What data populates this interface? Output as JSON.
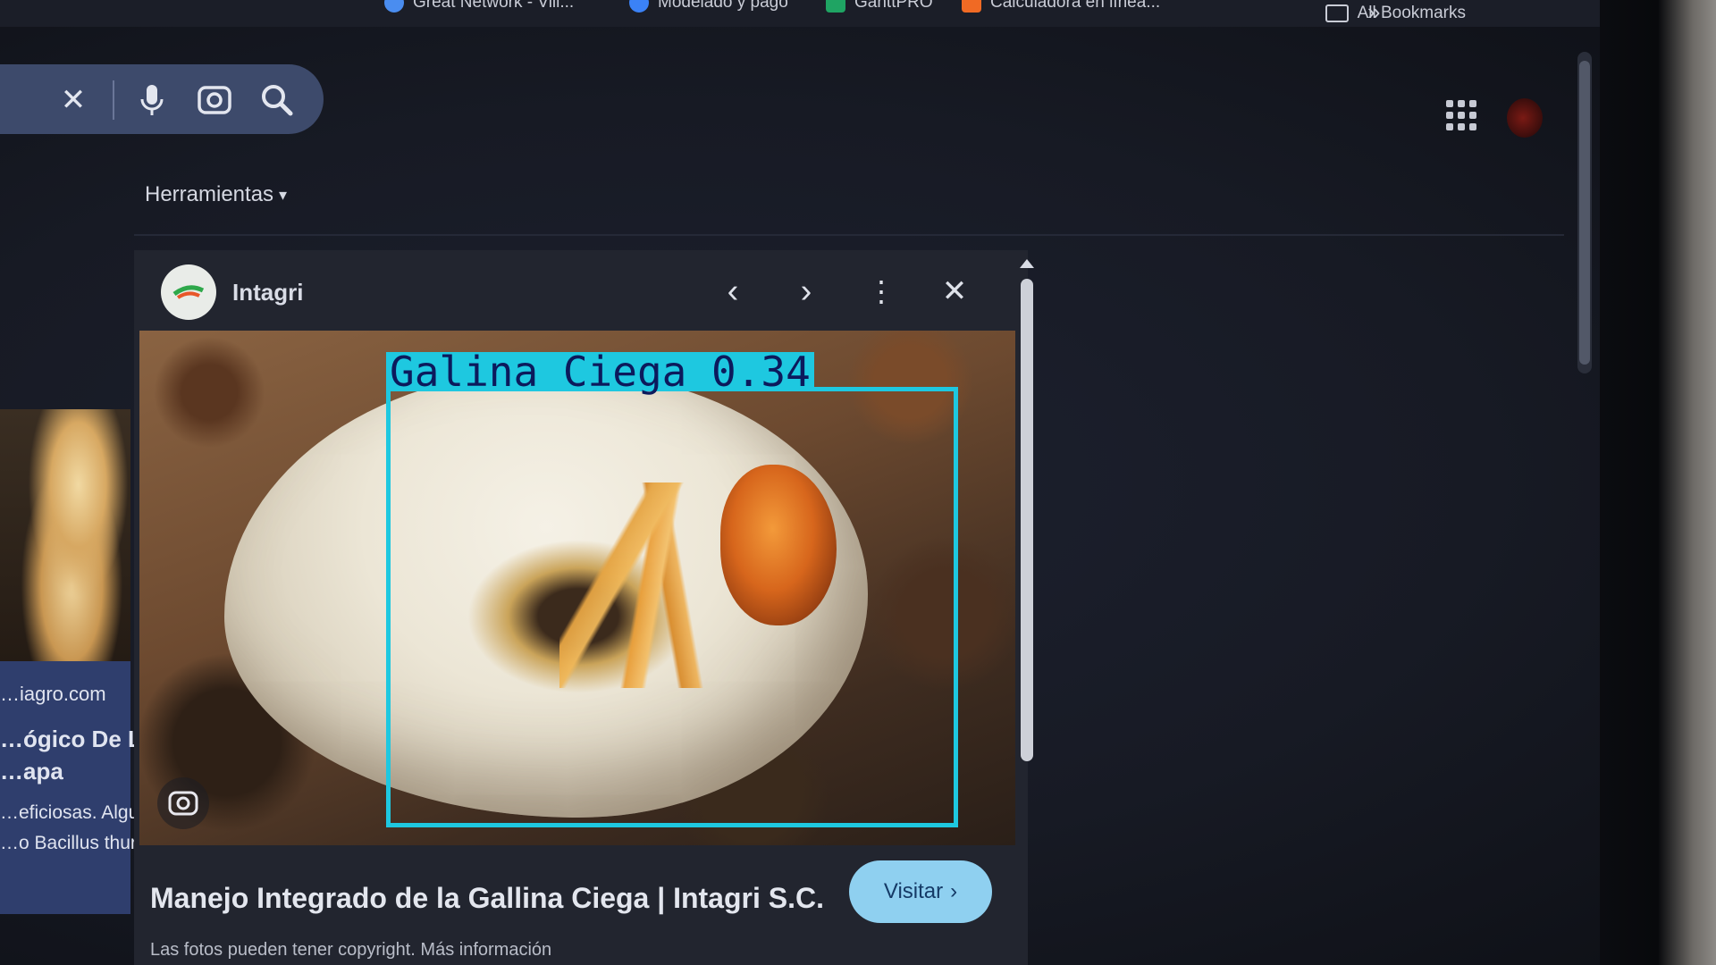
{
  "bookmarks": {
    "items": [
      {
        "label": "Great Network - Vill...",
        "color": "#4a8df0"
      },
      {
        "label": "Modelado y pago",
        "color": "#3b82f6"
      },
      {
        "label": "GanttPRO",
        "color": "#1fa463"
      },
      {
        "label": "Calculadora en línea...",
        "color": "#f06a24"
      }
    ],
    "overflow_icon": "chevron-double-right-icon",
    "all_bookmarks_label": "All Bookmarks"
  },
  "search": {
    "clear_icon": "✕",
    "voice_icon": "🎤",
    "lens_icon": "⊙",
    "search_icon": "🔍"
  },
  "toolbar": {
    "tools_label": "Herramientas",
    "tools_arrow": "▾"
  },
  "left_result": {
    "source": "…iagro.com",
    "title_line1": "…ógico De La G",
    "title_line2": "…apa",
    "snippet_line1": "…eficiosas. Algun",
    "snippet_line2": "…o Bacillus thur"
  },
  "preview": {
    "site_name": "Intagri",
    "prev_icon": "‹",
    "next_icon": "›",
    "more_icon": "⋮",
    "close_icon": "✕",
    "title": "Manejo Integrado de la Gallina Ciega | Intagri S.C.",
    "visit_label": "Visitar",
    "visit_icon": "›",
    "copyright": "Las fotos pueden tener copyright. Más información",
    "lens_badge_icon": "⊙"
  },
  "detection": {
    "label": "Galina Ciega 0.34",
    "color": "#1ec8e0"
  }
}
